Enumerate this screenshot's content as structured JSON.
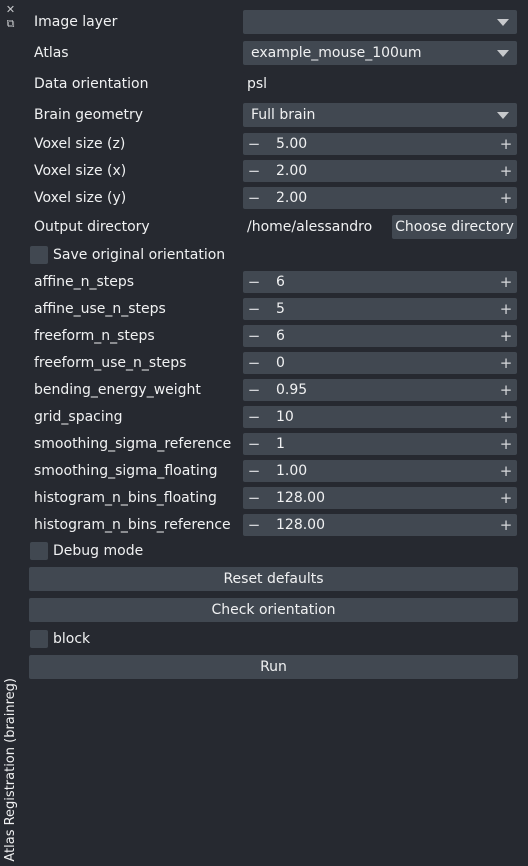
{
  "sidebar": {
    "close_icon": "close-icon",
    "float_icon": "float-icon",
    "title": "Atlas Registration (brainreg)"
  },
  "fields": {
    "image_layer": {
      "label": "Image layer",
      "value": ""
    },
    "atlas": {
      "label": "Atlas",
      "value": "example_mouse_100um"
    },
    "data_orientation": {
      "label": "Data orientation",
      "value": "psl"
    },
    "brain_geometry": {
      "label": "Brain geometry",
      "value": "Full brain"
    },
    "voxel_z": {
      "label": "Voxel size (z)",
      "value": "5.00"
    },
    "voxel_x": {
      "label": "Voxel size (x)",
      "value": "2.00"
    },
    "voxel_y": {
      "label": "Voxel size (y)",
      "value": "2.00"
    },
    "output_directory": {
      "label": "Output directory",
      "value": "/home/alessandro",
      "button": "Choose directory"
    },
    "save_original_orientation": {
      "label": "Save original orientation",
      "checked": false
    },
    "affine_n_steps": {
      "label": "affine_n_steps",
      "value": "6"
    },
    "affine_use_n_steps": {
      "label": "affine_use_n_steps",
      "value": "5"
    },
    "freeform_n_steps": {
      "label": "freeform_n_steps",
      "value": "6"
    },
    "freeform_use_n_steps": {
      "label": "freeform_use_n_steps",
      "value": "0"
    },
    "bending_energy_weight": {
      "label": "bending_energy_weight",
      "value": "0.95"
    },
    "grid_spacing": {
      "label": "grid_spacing",
      "value": "10"
    },
    "smoothing_sigma_reference": {
      "label": "smoothing_sigma_reference",
      "value": "1"
    },
    "smoothing_sigma_floating": {
      "label": "smoothing_sigma_floating",
      "value": "1.00"
    },
    "histogram_n_bins_floating": {
      "label": "histogram_n_bins_floating",
      "value": "128.00"
    },
    "histogram_n_bins_reference": {
      "label": "histogram_n_bins_reference",
      "value": "128.00"
    },
    "debug_mode": {
      "label": "Debug mode",
      "checked": false
    }
  },
  "buttons": {
    "reset_defaults": "Reset defaults",
    "check_orientation": "Check orientation",
    "run": "Run"
  },
  "block": {
    "label": "block",
    "checked": false
  },
  "spin": {
    "minus": "−",
    "plus": "+"
  },
  "colors": {
    "background": "#262930",
    "widget": "#414851",
    "text": "#f0f1f2"
  }
}
